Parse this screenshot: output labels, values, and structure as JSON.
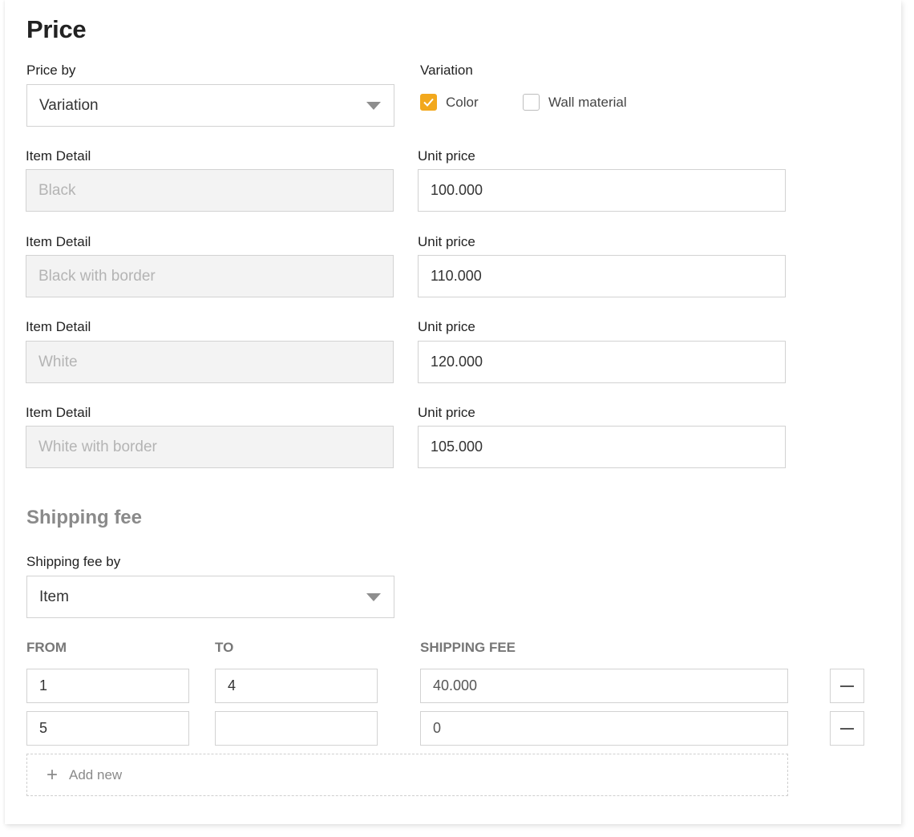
{
  "price": {
    "title": "Price",
    "price_by_label": "Price by",
    "price_by_value": "Variation",
    "variation_label": "Variation",
    "variations": [
      {
        "label": "Color",
        "checked": true
      },
      {
        "label": "Wall material",
        "checked": false
      }
    ],
    "item_detail_label": "Item Detail",
    "unit_price_label": "Unit price",
    "items": [
      {
        "detail": "Black",
        "unit_price": "100.000"
      },
      {
        "detail": "Black with border",
        "unit_price": "110.000"
      },
      {
        "detail": "White",
        "unit_price": "120.000"
      },
      {
        "detail": "White with border",
        "unit_price": "105.000"
      }
    ]
  },
  "shipping": {
    "title": "Shipping fee",
    "fee_by_label": "Shipping fee by",
    "fee_by_value": "Item",
    "columns": {
      "from": "FROM",
      "to": "TO",
      "fee": "SHIPPING FEE"
    },
    "rows": [
      {
        "from": "1",
        "to": "4",
        "fee": "40.000"
      },
      {
        "from": "5",
        "to": "",
        "fee": "0"
      }
    ],
    "add_new_label": "Add new"
  },
  "colors": {
    "accent": "#f2a81d",
    "disabled_bg": "#f3f3f3",
    "border": "#d2d2d2"
  },
  "icons": {
    "dropdown": "caret-down-icon",
    "checkbox": "check-icon",
    "remove": "minus-icon",
    "add": "plus-icon"
  }
}
